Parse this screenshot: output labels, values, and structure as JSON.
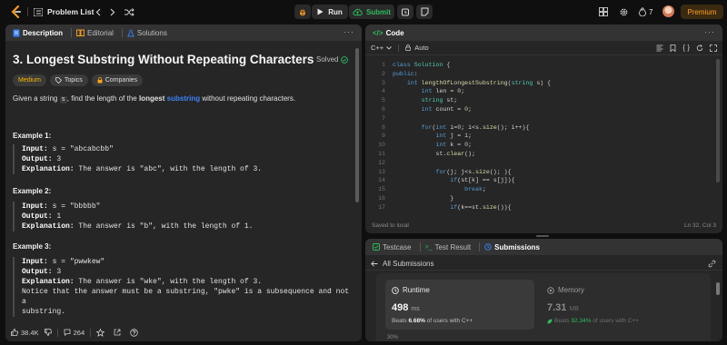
{
  "topbar": {
    "problem_list": "Problem List",
    "run": "Run",
    "submit": "Submit",
    "streak": "7",
    "premium": "Premium"
  },
  "left": {
    "tabs": [
      "Description",
      "Editorial",
      "Solutions"
    ],
    "title": "3. Longest Substring Without Repeating Characters",
    "solved": "Solved",
    "difficulty": "Medium",
    "topics": "Topics",
    "companies": "Companies",
    "desc": {
      "p1": "Given a string ",
      "code": "s",
      "p2": ", find the length of the ",
      "bold": "longest",
      "link": "substring",
      "p3": " without repeating characters."
    },
    "examples": [
      {
        "title": "Example 1:",
        "input_label": "Input:",
        "input": "s = \"abcabcbb\"",
        "output_label": "Output:",
        "output": "3",
        "expl_label": "Explanation:",
        "expl": "The answer is \"abc\", with the length of 3."
      },
      {
        "title": "Example 2:",
        "input_label": "Input:",
        "input": "s = \"bbbbb\"",
        "output_label": "Output:",
        "output": "1",
        "expl_label": "Explanation:",
        "expl": "The answer is \"b\", with the length of 1."
      },
      {
        "title": "Example 3:",
        "input_label": "Input:",
        "input": "s = \"pwwkew\"",
        "output_label": "Output:",
        "output": "3",
        "expl_label": "Explanation:",
        "expl": "The answer is \"wke\", with the length of 3.",
        "note1": "Notice that the answer must be a substring, \"pwke\" is a subsequence and not a",
        "note2": "substring."
      }
    ],
    "footer": {
      "likes": "38.4K",
      "comments": "264"
    }
  },
  "code": {
    "tab": "Code",
    "language": "C++",
    "auto": "Auto",
    "status_left": "Saved to local",
    "status_right": "Ln 32, Col 3",
    "lines": [
      "class Solution {",
      "public:",
      "    int lengthOfLongestSubstring(string s) {",
      "        int len = 0;",
      "        string st;",
      "        int count = 0;",
      "",
      "        for(int i=0; i<s.size(); i++){",
      "            int j = i;",
      "            int k = 0;",
      "            st.clear();",
      "",
      "            for(j; j<s.size(); ){",
      "                if(st[k] == s[j]){",
      "                    break;",
      "                }",
      "                if(k==st.size()){"
    ]
  },
  "result": {
    "tabs": [
      "Testcase",
      "Test Result",
      "Submissions"
    ],
    "all_submissions": "All Submissions",
    "runtime_label": "Runtime",
    "runtime_value": "498",
    "runtime_unit": "ms",
    "runtime_beats_pre": "Beats ",
    "runtime_beats": "6.68%",
    "runtime_beats_post": " of users with C++",
    "memory_label": "Memory",
    "memory_value": "7.31",
    "memory_unit": "MB",
    "memory_beats_pre": "Beats ",
    "memory_beats": "92.34%",
    "memory_beats_post": " of users with C++",
    "axis_label": "30%"
  },
  "colors": {
    "accent_orange": "#ffa116",
    "easy_green": "#2cbb5d",
    "medium_amber": "#ffb800",
    "link_blue": "#3b82f6"
  }
}
